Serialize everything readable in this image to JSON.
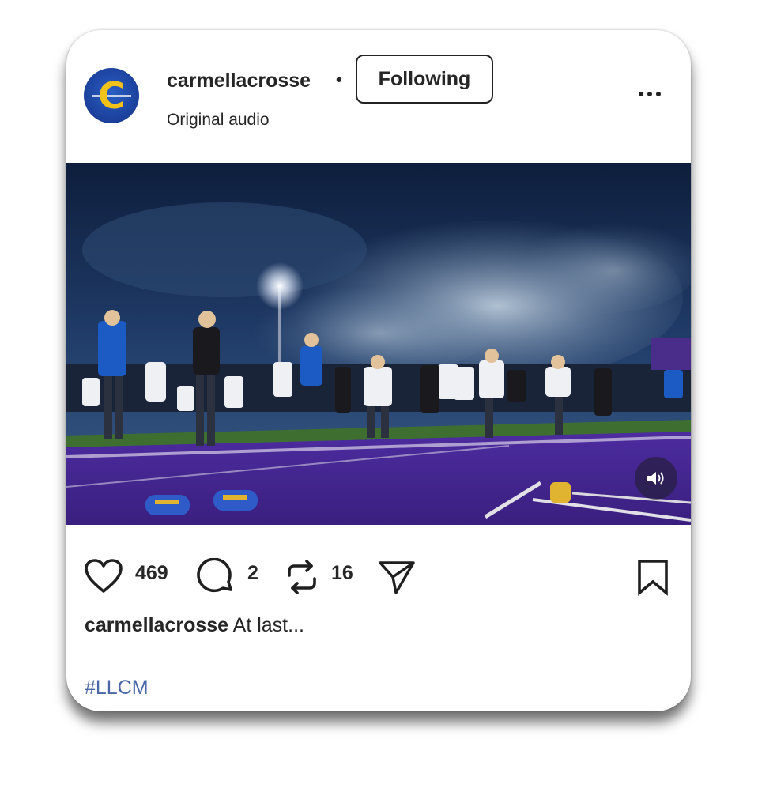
{
  "post": {
    "username": "carmellacrosse",
    "separator": "•",
    "follow_label": "Following",
    "audio": "Original audio",
    "more_icon": "more-horizontal-icon"
  },
  "media": {
    "description_icon": "video-player",
    "sound_icon": "speaker-icon"
  },
  "actions": {
    "likes": "469",
    "comments": "2",
    "reposts": "16"
  },
  "caption": {
    "username": "carmellacrosse",
    "text": " At last..."
  },
  "hashtag": "#LLCM",
  "colors": {
    "accent_link": "#4a67a8",
    "avatar_blue": "#1b3f9a",
    "avatar_gold": "#f2c21a",
    "turf_purple": "#4b2a9c",
    "field_green": "#3d6b2e"
  }
}
